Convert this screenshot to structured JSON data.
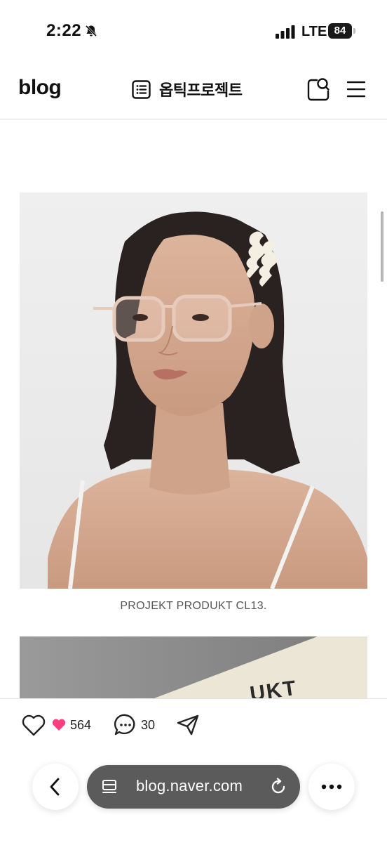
{
  "status_bar": {
    "time": "2:22",
    "network": "LTE",
    "battery": "84",
    "icons": [
      "bell-muted-icon",
      "signal-icon"
    ]
  },
  "header": {
    "logo": "blog",
    "title": "옵틱프로젝트",
    "icons": [
      "list-icon",
      "search-icon",
      "menu-icon"
    ]
  },
  "post": {
    "images": [
      {
        "kind": "product-photo",
        "subject": "model wearing clear eyeglasses"
      },
      {
        "kind": "product-photo",
        "subject": "cream card",
        "visible_text": "UKT"
      }
    ],
    "caption": "PROJEKT PRODUKT CL13."
  },
  "actions": {
    "like_count": "564",
    "comment_count": "30",
    "icons": [
      "heart-outline-icon",
      "heart-filled-icon",
      "comment-icon",
      "share-icon"
    ],
    "accent_color": "#ff3d7f"
  },
  "browser": {
    "url": "blog.naver.com",
    "icons": [
      "back-icon",
      "tabs-icon",
      "reload-icon",
      "more-icon"
    ]
  }
}
